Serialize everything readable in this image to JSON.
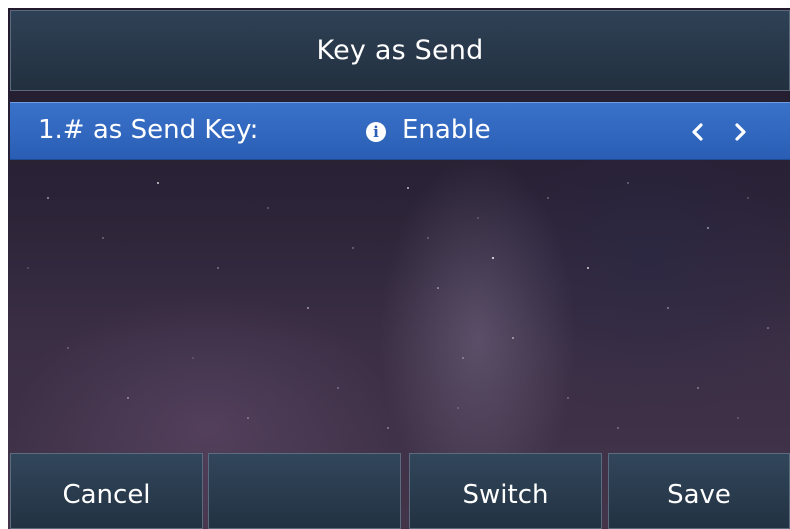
{
  "title_bar": {
    "title": "Key as Send"
  },
  "setting_row": {
    "label": "1.# as Send Key:",
    "info_icon": "info-circle-icon",
    "value": "Enable",
    "left_arrow_icon": "chevron-left-icon",
    "right_arrow_icon": "chevron-right-icon"
  },
  "softkeys": [
    {
      "label": "Cancel"
    },
    {
      "label": ""
    },
    {
      "label": "Switch"
    },
    {
      "label": "Save"
    }
  ],
  "colors": {
    "title_bar": "#2f4156",
    "selected_row": "#3a72c9",
    "softkey": "#32465b",
    "text": "#ffffff"
  }
}
